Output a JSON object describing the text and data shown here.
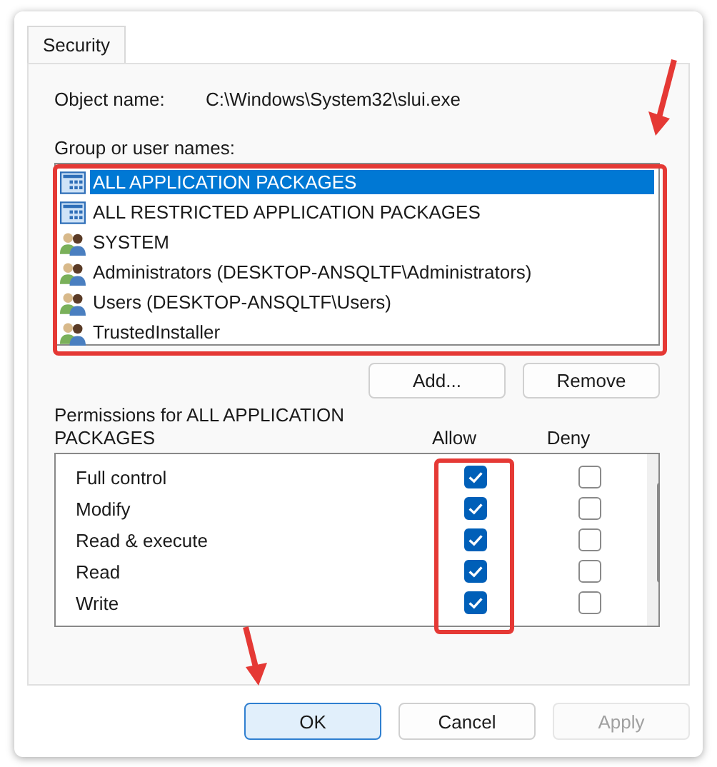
{
  "tabs": [
    {
      "label": "Security",
      "selected": true
    }
  ],
  "object_name": {
    "label": "Object name:",
    "value": "C:\\Windows\\System32\\slui.exe"
  },
  "groups": {
    "label": "Group or user names:",
    "items": [
      {
        "name": "ALL APPLICATION PACKAGES",
        "kind": "package",
        "selected": true
      },
      {
        "name": "ALL RESTRICTED APPLICATION PACKAGES",
        "kind": "package",
        "selected": false
      },
      {
        "name": "SYSTEM",
        "kind": "users",
        "selected": false
      },
      {
        "name": "Administrators (DESKTOP-ANSQLTF\\Administrators)",
        "kind": "users",
        "selected": false
      },
      {
        "name": "Users (DESKTOP-ANSQLTF\\Users)",
        "kind": "users",
        "selected": false
      },
      {
        "name": "TrustedInstaller",
        "kind": "users",
        "selected": false
      }
    ]
  },
  "group_buttons": [
    {
      "label": "Add..."
    },
    {
      "label": "Remove"
    }
  ],
  "permissions": {
    "label": "Permissions for ALL APPLICATION PACKAGES",
    "allow_header": "Allow",
    "deny_header": "Deny",
    "rows": [
      {
        "name": "Full control",
        "allow": true,
        "deny": false
      },
      {
        "name": "Modify",
        "allow": true,
        "deny": false
      },
      {
        "name": "Read & execute",
        "allow": true,
        "deny": false
      },
      {
        "name": "Read",
        "allow": true,
        "deny": false
      },
      {
        "name": "Write",
        "allow": true,
        "deny": false
      }
    ]
  },
  "buttons": [
    {
      "label": "OK",
      "default": true,
      "disabled": false
    },
    {
      "label": "Cancel",
      "default": false,
      "disabled": false
    },
    {
      "label": "Apply",
      "default": false,
      "disabled": true
    }
  ]
}
